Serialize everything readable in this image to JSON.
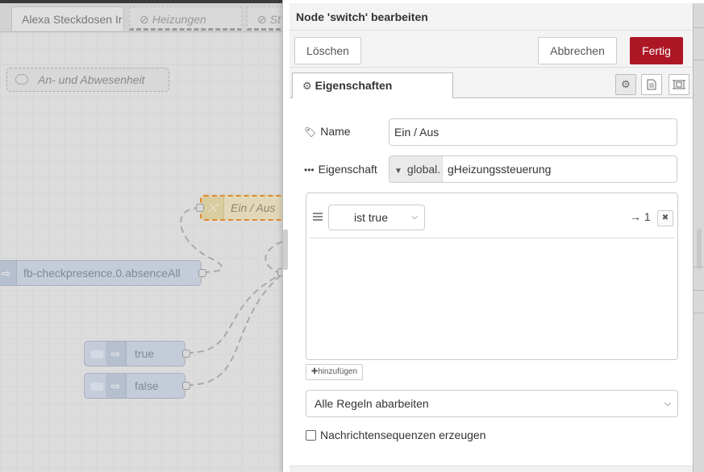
{
  "workspace": {
    "tabs": [
      {
        "label": "Alexa Steckdosen Ir",
        "disabled": false
      },
      {
        "label": "Heizungen",
        "disabled": true
      },
      {
        "label": "St",
        "disabled": true
      }
    ],
    "comment": "An- und Abwesenheit",
    "nodes": {
      "switch_label": "Ein / Aus",
      "presence_label": "fb-checkpresence.0.absenceAll",
      "true_label": "true",
      "false_label": "false"
    }
  },
  "tray": {
    "title": "Node 'switch' bearbeiten",
    "buttons": {
      "delete": "Löschen",
      "cancel": "Abbrechen",
      "done": "Fertig"
    },
    "tab_label": "Eigenschaften",
    "icons": {
      "tab": "gear-icon",
      "settings": "gear-icon",
      "description": "document-icon",
      "appearance": "frame-icon"
    },
    "name_label": "Name",
    "name_value": "Ein / Aus",
    "property_label": "Eigenschaft",
    "property_type": "global.",
    "property_value": "gHeizungssteuerung",
    "rules": [
      {
        "operator": "ist true",
        "output": "→ 1"
      }
    ],
    "add_button": "hinzufügen",
    "check_all_option": "Alle Regeln abarbeiten",
    "sequences_checkbox_label": "Nachrichtensequenzen erzeugen",
    "sequences_checked": false
  },
  "colors": {
    "done_button": "#ad1625",
    "selected_node_border": "#e08a2f"
  }
}
